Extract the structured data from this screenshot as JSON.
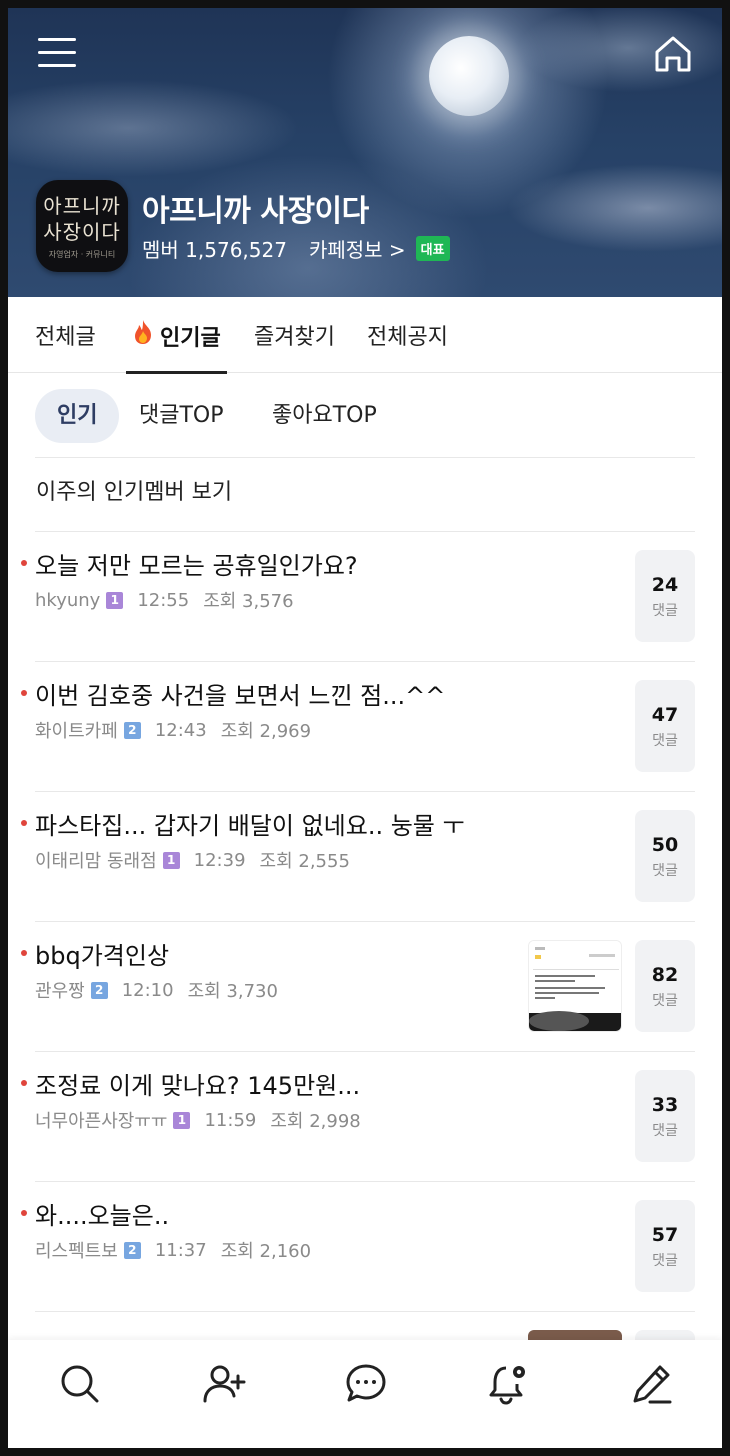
{
  "header": {
    "cafe_name": "아프니까 사장이다",
    "member_label": "멤버 1,576,527",
    "cafe_info": "카페정보 >",
    "rep_badge": "대표",
    "logo_line1": "아프니까",
    "logo_line2": "사장이다",
    "logo_small": "자영업자 · 커뮤니티"
  },
  "tabs": [
    "전체글",
    "인기글",
    "즐겨찾기",
    "전체공지"
  ],
  "active_tab": "인기글",
  "subtabs": [
    "인기",
    "댓글TOP",
    "좋아요TOP"
  ],
  "members_link": "이주의 인기멤버 보기",
  "posts": [
    {
      "title": "오늘 저만 모르는 공휴일인가요?",
      "author": "hkyuny",
      "level": "1",
      "time": "12:55",
      "views": "조회 3,576",
      "comments": "24",
      "comment_label": "댓글"
    },
    {
      "title": "이번 김호중 사건을 보면서 느낀 점...^^",
      "author": "화이트카페",
      "level": "2",
      "time": "12:43",
      "views": "조회 2,969",
      "comments": "47",
      "comment_label": "댓글"
    },
    {
      "title": "파스타집... 갑자기 배달이 없네요.. 눙물 ㅜ",
      "author": "이태리맘 동래점",
      "level": "1",
      "time": "12:39",
      "views": "조회 2,555",
      "comments": "50",
      "comment_label": "댓글"
    },
    {
      "title": "bbq가격인상",
      "author": "관우짱",
      "level": "2",
      "time": "12:10",
      "views": "조회 3,730",
      "comments": "82",
      "comment_label": "댓글"
    },
    {
      "title": "조정료 이게 맞나요? 145만원...",
      "author": "너무아픈사장ㅠㅠ",
      "level": "1",
      "time": "11:59",
      "views": "조회 2,998",
      "comments": "33",
      "comment_label": "댓글"
    },
    {
      "title": "와....오늘은..",
      "author": "리스펙트보",
      "level": "2",
      "time": "11:37",
      "views": "조회 2,160",
      "comments": "57",
      "comment_label": "댓글"
    }
  ],
  "nav": [
    "search-icon",
    "add-member-icon",
    "chat-icon",
    "notification-settings-icon",
    "write-icon"
  ],
  "colors": {
    "accent_dot": "#e0453c",
    "badge_green": "#1fb755",
    "chip_bg": "#e9edf4"
  }
}
